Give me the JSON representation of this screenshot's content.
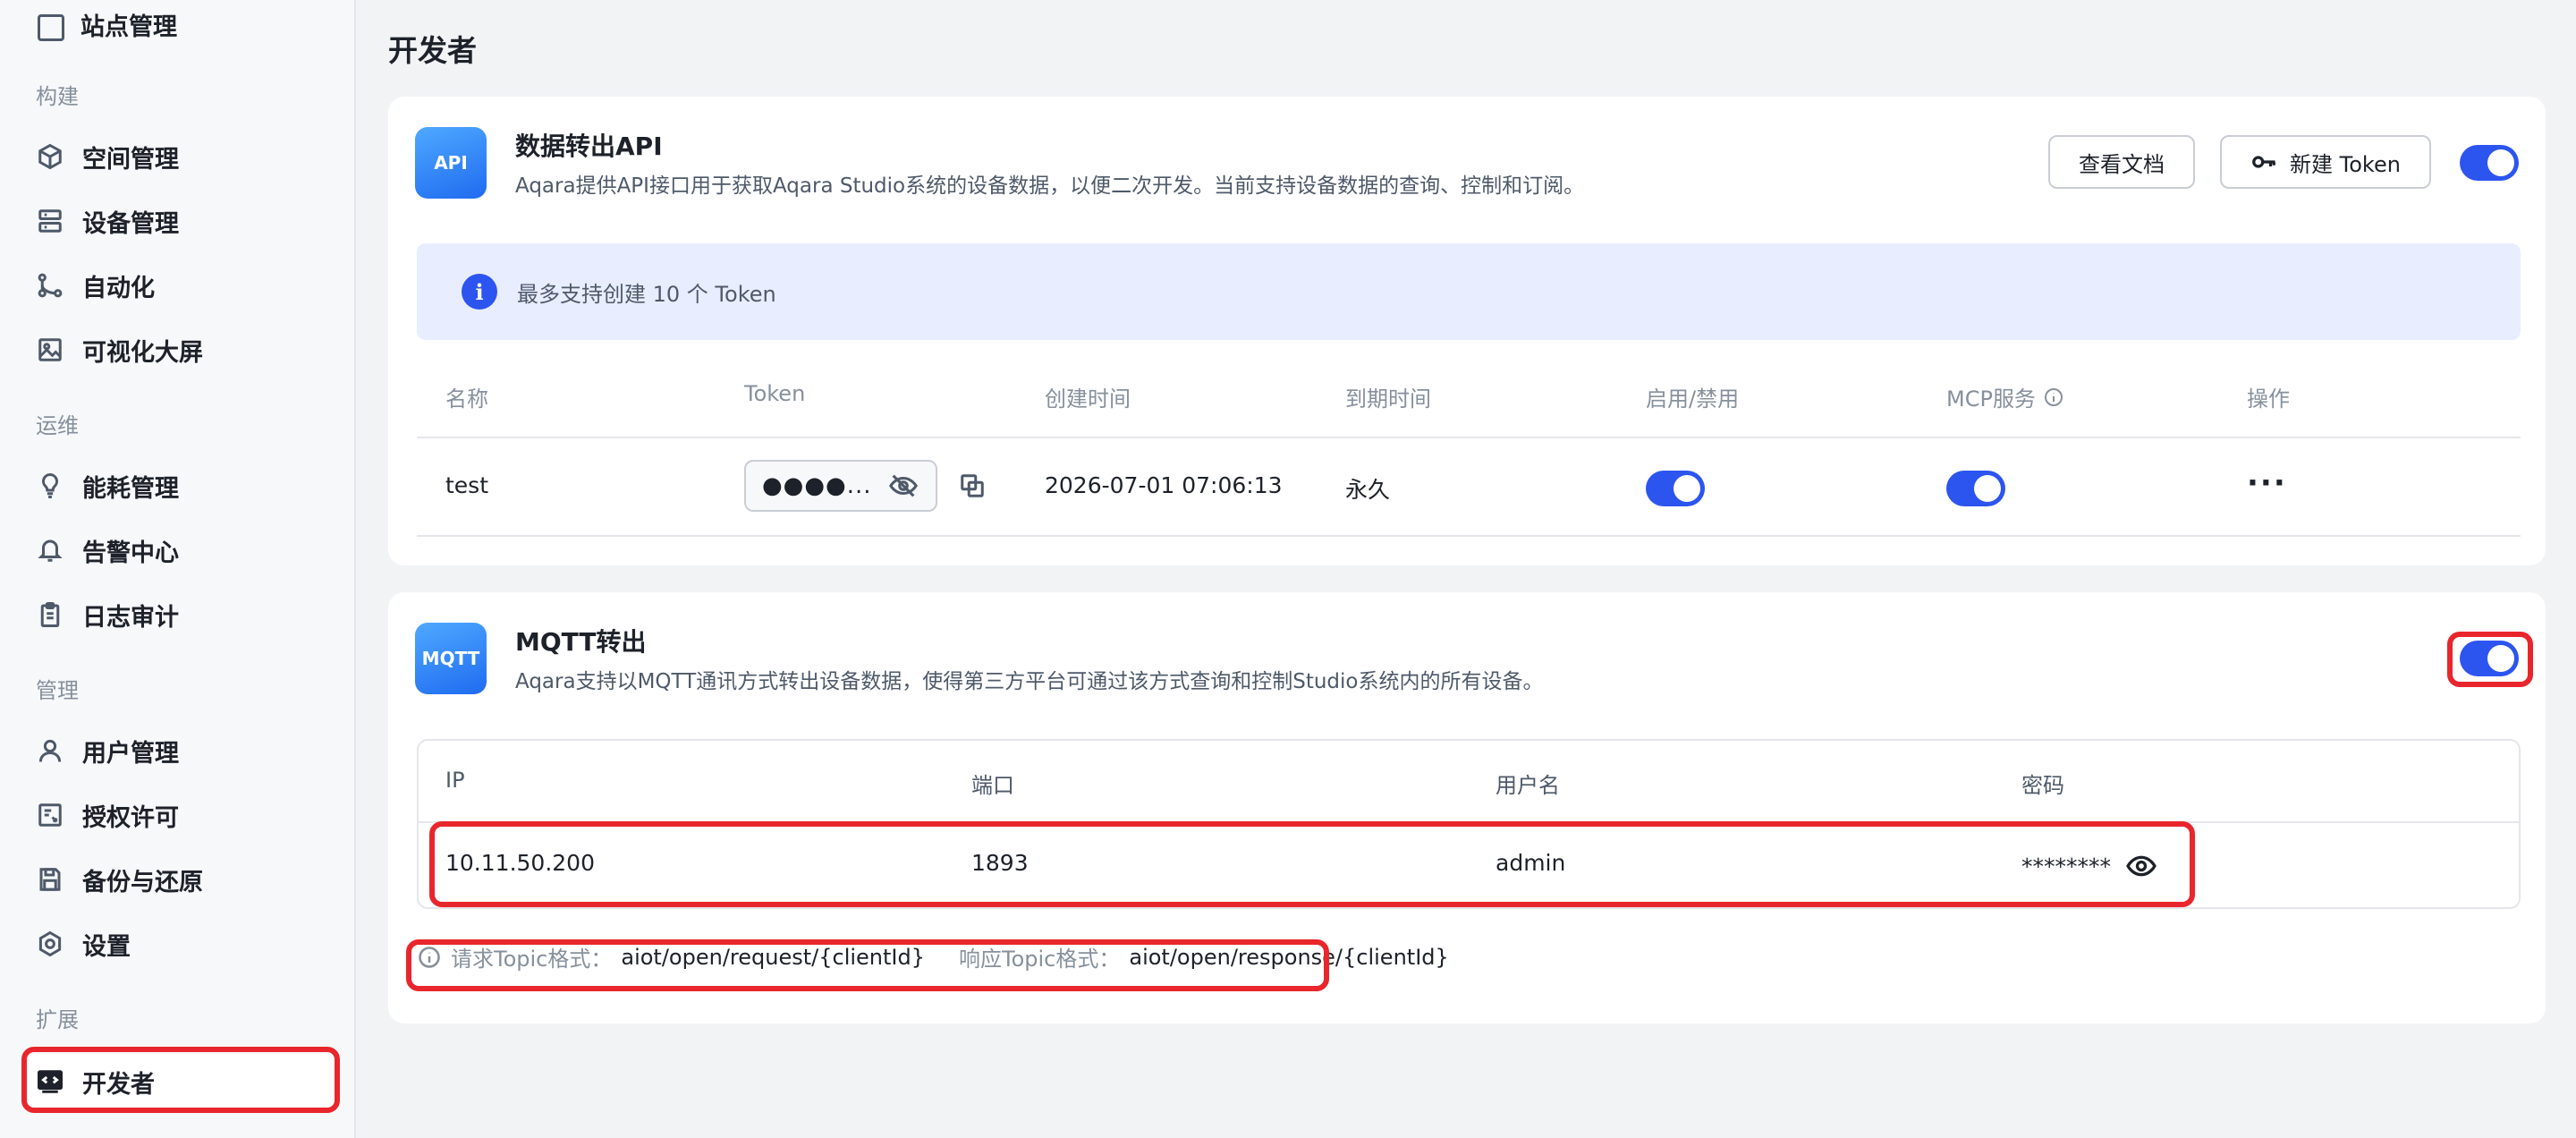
{
  "sidebar": {
    "cut_item": "站点管理",
    "groups": [
      "构建",
      "运维",
      "管理",
      "扩展"
    ],
    "items": [
      {
        "label": "空间管理",
        "icon": "cube-icon"
      },
      {
        "label": "设备管理",
        "icon": "server-icon"
      },
      {
        "label": "自动化",
        "icon": "automation-icon"
      },
      {
        "label": "可视化大屏",
        "icon": "image-icon"
      },
      {
        "label": "能耗管理",
        "icon": "bulb-icon"
      },
      {
        "label": "告警中心",
        "icon": "bell-icon"
      },
      {
        "label": "日志审计",
        "icon": "clipboard-icon"
      },
      {
        "label": "用户管理",
        "icon": "user-icon"
      },
      {
        "label": "授权许可",
        "icon": "license-icon"
      },
      {
        "label": "备份与还原",
        "icon": "save-icon"
      },
      {
        "label": "设置",
        "icon": "hexagon-gear-icon"
      },
      {
        "label": "开发者",
        "icon": "code-icon",
        "active": true
      }
    ]
  },
  "page": {
    "title": "开发者"
  },
  "api": {
    "badge": "API",
    "title": "数据转出API",
    "desc": "Aqara提供API接口用于获取Aqara Studio系统的设备数据，以便二次开发。当前支持设备数据的查询、控制和订阅。",
    "docs_button": "查看文档",
    "new_token_button": "新建 Token",
    "enabled": true,
    "notice": "最多支持创建 10 个 Token",
    "columns": [
      "名称",
      "Token",
      "创建时间",
      "到期时间",
      "启用/禁用",
      "MCP服务",
      "操作"
    ],
    "rows": [
      {
        "name": "test",
        "token_masked": "●●●●...",
        "created": "2026-07-01 07:06:13",
        "expires": "永久",
        "enabled": true,
        "mcp": true,
        "more": "···"
      }
    ]
  },
  "mqtt": {
    "badge": "MQTT",
    "title": "MQTT转出",
    "desc": "Aqara支持以MQTT通讯方式转出设备数据，使得第三方平台可通过该方式查询和控制Studio系统内的所有设备。",
    "enabled": true,
    "columns": [
      "IP",
      "端口",
      "用户名",
      "密码"
    ],
    "row": {
      "ip": "10.11.50.200",
      "port": "1893",
      "username": "admin",
      "password": "********"
    },
    "request_label": "请求Topic格式：",
    "request_value": "aiot/open/request/{clientId}",
    "response_label": "响应Topic格式：",
    "response_value": "aiot/open/response/{clientId}"
  },
  "colors": {
    "accent": "#2c55f0",
    "highlight": "#e8262c",
    "notice_bg": "#e8edff"
  }
}
